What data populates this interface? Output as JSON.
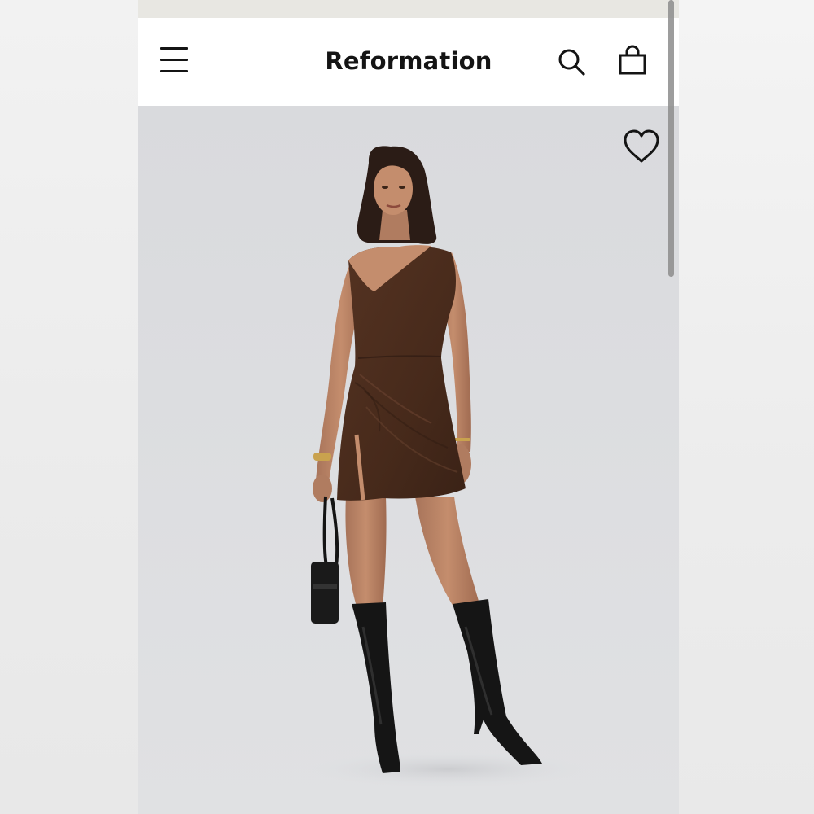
{
  "header": {
    "brand": "Reformation",
    "menu_icon": "hamburger-menu-icon",
    "search_icon": "search-icon",
    "bag_icon": "shopping-bag-icon"
  },
  "product_image": {
    "wishlist_icon": "heart-icon"
  },
  "colors": {
    "header_background": "#ffffff",
    "icon_color": "#141414",
    "photo_background": "#dcdde0",
    "dress": "#4a2c1c",
    "boots": "#151515"
  }
}
